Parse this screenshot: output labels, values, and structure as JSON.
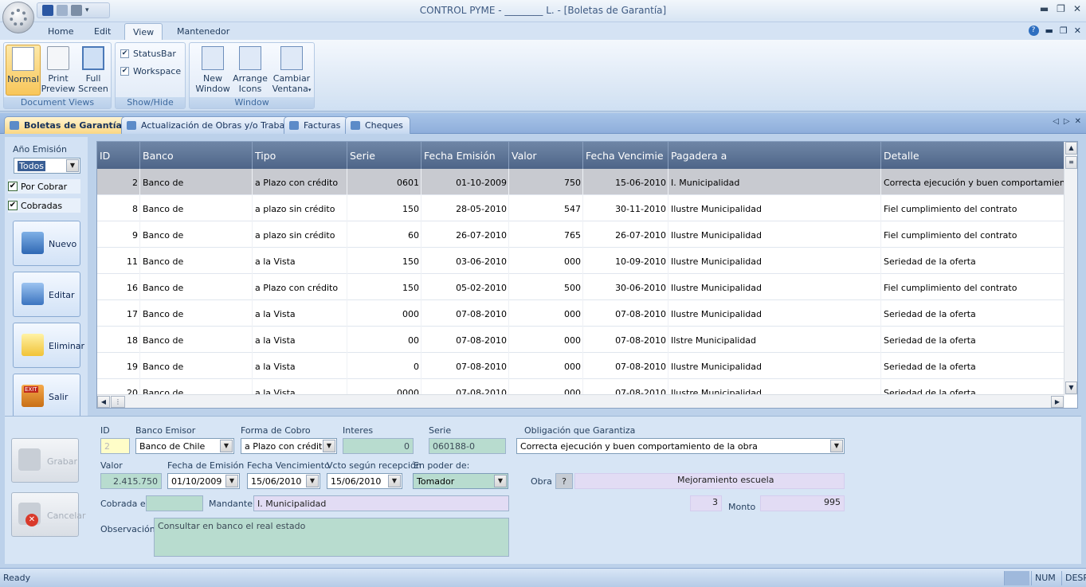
{
  "window": {
    "title": "CONTROL PYME - ________ L. - [Boletas de Garantía]"
  },
  "ribbon_tabs": [
    "Home",
    "Edit",
    "View",
    "Mantenedor"
  ],
  "ribbon": {
    "groups": {
      "document_views": "Document Views",
      "show_hide": "Show/Hide",
      "window": "Window"
    },
    "buttons": {
      "normal": "Normal",
      "print_preview_1": "Print",
      "print_preview_2": "Preview",
      "full_screen_1": "Full",
      "full_screen_2": "Screen",
      "new_window_1": "New",
      "new_window_2": "Window",
      "arrange_icons_1": "Arrange",
      "arrange_icons_2": "Icons",
      "cambiar_ventana_1": "Cambiar",
      "cambiar_ventana_2": "Ventana"
    },
    "checks": {
      "statusbar": "StatusBar",
      "workspace": "Workspace"
    }
  },
  "doc_tabs": [
    "Boletas de Garantía",
    "Actualización de Obras y/o Trabajos",
    "Facturas",
    "Cheques"
  ],
  "left_panel": {
    "anio_label": "Año Emisión",
    "anio_value": "Todos",
    "por_cobrar": "Por Cobrar",
    "cobradas": "Cobradas",
    "nuevo": "Nuevo",
    "editar": "Editar",
    "eliminar": "Eliminar",
    "salir": "Salir",
    "exit_sign": "EXIT"
  },
  "grid": {
    "columns": [
      "ID",
      "Banco",
      "Tipo",
      "Serie",
      "Fecha Emisión",
      "Valor",
      "Fecha Vencimie",
      "Pagadera a",
      "Detalle"
    ],
    "rows": [
      [
        "2",
        "Banco de",
        "a Plazo con crédito",
        "0601",
        "01-10-2009",
        "750",
        "15-06-2010",
        "I. Municipalidad",
        "Correcta ejecución y buen comportamiento de la"
      ],
      [
        "8",
        "Banco de",
        "a plazo sin crédito",
        "150",
        "28-05-2010",
        "547",
        "30-11-2010",
        "Ilustre Municipalidad",
        "Fiel cumplimiento del contrato"
      ],
      [
        "9",
        "Banco de",
        "a plazo sin crédito",
        "60",
        "26-07-2010",
        "765",
        "26-07-2010",
        "Ilustre Municipalidad",
        "Fiel cumplimiento del contrato"
      ],
      [
        "11",
        "Banco de",
        "a la Vista",
        "150",
        "03-06-2010",
        "000",
        "10-09-2010",
        "Ilustre Municipalidad",
        "Seriedad de la oferta"
      ],
      [
        "16",
        "Banco de",
        "a Plazo con crédito",
        "150",
        "05-02-2010",
        "500",
        "30-06-2010",
        "Ilustre Municipalidad",
        "Fiel cumplimiento del contrato"
      ],
      [
        "17",
        "Banco de",
        "a la Vista",
        "000",
        "07-08-2010",
        "000",
        "07-08-2010",
        "Ilustre Municipalidad",
        "Seriedad de la oferta"
      ],
      [
        "18",
        "Banco de",
        "a la Vista",
        "00",
        "07-08-2010",
        "000",
        "07-08-2010",
        "Ilstre Municipalidad",
        "Seriedad de la oferta"
      ],
      [
        "19",
        "Banco de",
        "a la Vista",
        "0",
        "07-08-2010",
        "000",
        "07-08-2010",
        "Ilustre Municipalidad",
        "Seriedad de la oferta"
      ],
      [
        "20",
        "Banco de",
        "a la Vista",
        "0000",
        "07-08-2010",
        "000",
        "07-08-2010",
        "Ilustre Municipalidad",
        "Seriedad de la oferta"
      ]
    ]
  },
  "detail": {
    "labels": {
      "id": "ID",
      "banco_emisor": "Banco Emisor",
      "forma_cobro": "Forma de Cobro",
      "interes": "Interes",
      "serie": "Serie",
      "obligacion": "Obligación que Garantiza",
      "valor": "Valor",
      "fecha_emision": "Fecha de Emisión",
      "fecha_vencimiento": "Fecha Vencimiento",
      "vcto_recepcion": "Vcto según recepción",
      "en_poder": "En poder de:",
      "obra": "Obra",
      "cobrada_el": "Cobrada el:",
      "mandante": "Mandante",
      "monto": "Monto",
      "observacion": "Observación"
    },
    "values": {
      "id": "2",
      "banco_emisor": "Banco de Chile",
      "forma_cobro": "a Plazo con crédito",
      "interes": "0",
      "serie": "060188-0",
      "obligacion": "Correcta ejecución y buen comportamiento de la obra",
      "valor": "2.415.750",
      "fecha_emision": "01/10/2009",
      "fecha_vencimiento": "15/06/2010",
      "vcto_recepcion": "15/06/2010",
      "en_poder": "Tomador",
      "obra_button": "?",
      "obra": "Mejoramiento escuela",
      "obra_num": "3",
      "cobrada_el": "",
      "mandante": "I. Municipalidad",
      "monto": "995",
      "observacion": "Consultar en banco el real estado"
    },
    "buttons": {
      "grabar": "Grabar",
      "cancelar": "Cancelar"
    }
  },
  "status": {
    "text": "Ready",
    "num": "NUM",
    "desp": "DESP"
  }
}
